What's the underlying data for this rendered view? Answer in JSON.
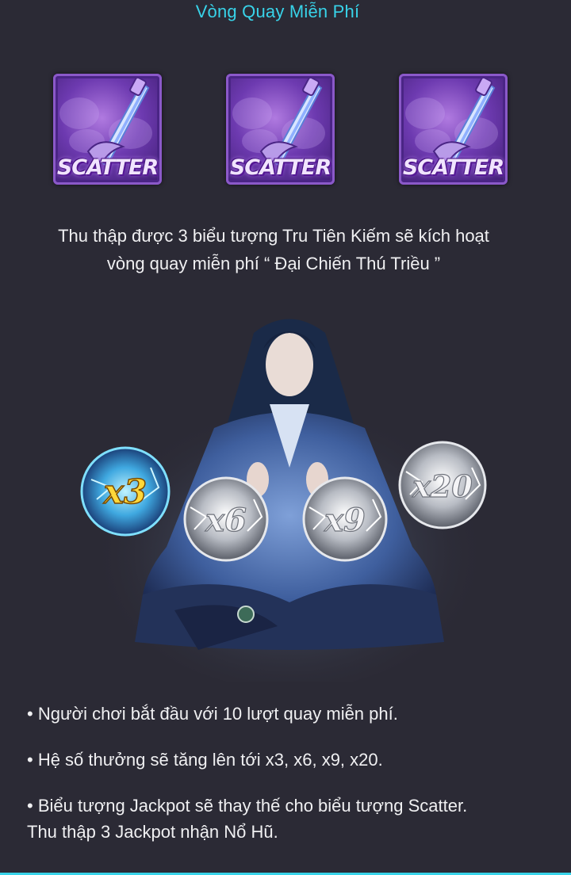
{
  "header": {
    "title": "Vòng Quay Miễn Phí"
  },
  "scatter_symbols": [
    {
      "label": "SCATTER"
    },
    {
      "label": "SCATTER"
    },
    {
      "label": "SCATTER"
    }
  ],
  "description": {
    "line1": "Thu thập được 3 biểu tượng Tru Tiên Kiếm sẽ kích hoạt",
    "line2": "vòng quay miễn phí “ Đại Chiến Thú Triều ”"
  },
  "multipliers": {
    "orb1": "x3",
    "orb2": "x6",
    "orb3": "x9",
    "orb4": "x20"
  },
  "bullets": {
    "item1": "• Người chơi bắt đầu với 10 lượt quay miễn phí.",
    "item2": "• Hệ số thưởng sẽ tăng lên tới x3, x6, x9, x20.",
    "item3_line1": "• Biểu tượng Jackpot sẽ thay thế cho biểu tượng Scatter.",
    "item3_line2": "Thu thập 3 Jackpot nhận Nổ Hũ."
  },
  "colors": {
    "background": "#2b2a35",
    "accent": "#38d3e9",
    "text": "#f0f0f2",
    "scatter_purple": "#6d3ab0"
  }
}
